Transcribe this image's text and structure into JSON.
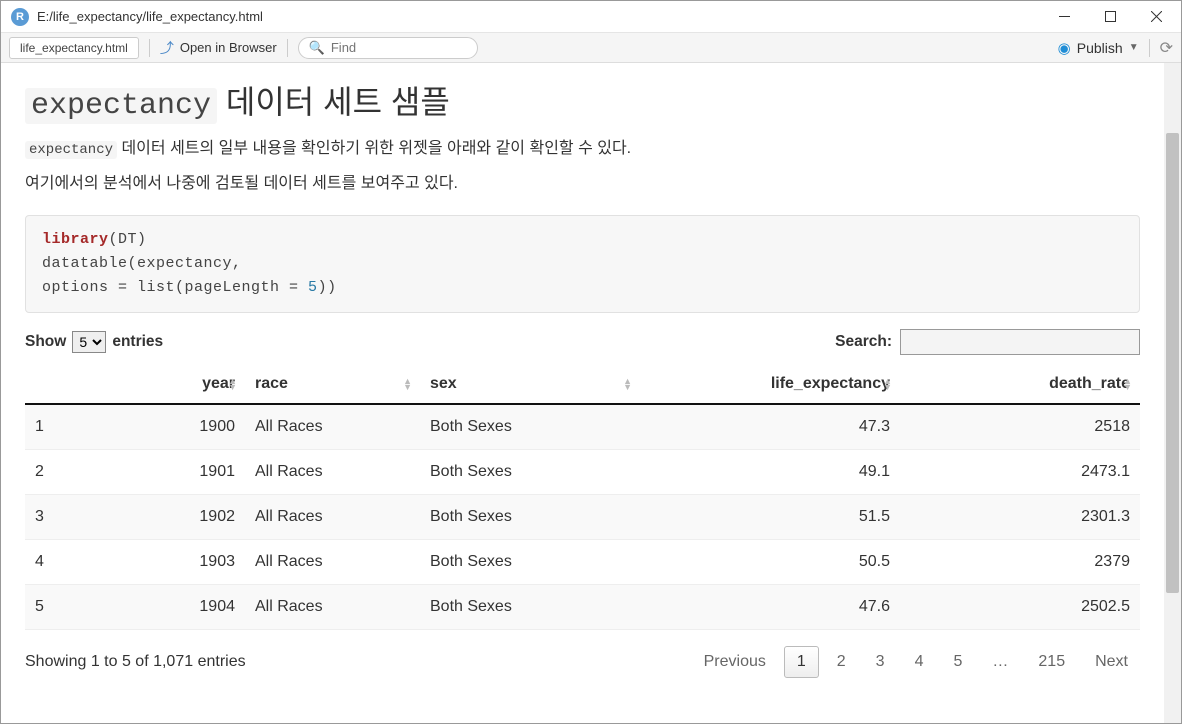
{
  "window": {
    "title": "E:/life_expectancy/life_expectancy.html",
    "app_icon_letter": "R"
  },
  "toolbar": {
    "file_tab": "life_expectancy.html",
    "open_browser": "Open in Browser",
    "find_placeholder": "Find",
    "publish": "Publish"
  },
  "page": {
    "heading_code": "expectancy",
    "heading_rest": " 데이터 세트 샘플",
    "intro_code": "expectancy",
    "intro_rest": " 데이터 세트의 일부 내용을 확인하기 위한 위젯을 아래와 같이 확인할 수 있다.",
    "intro2": "여기에서의 분석에서 나중에 검토될 데이터 세트를 보여주고 있다."
  },
  "code": {
    "kw": "library",
    "line1_rest": "(DT)",
    "line2": "datatable(expectancy,",
    "line3a": "options = list(pageLength = ",
    "line3_num": "5",
    "line3b": "))"
  },
  "dt": {
    "show": "Show",
    "entries": "entries",
    "page_length": "5",
    "search_label": "Search:",
    "search_value": "",
    "columns": [
      "",
      "year",
      "race",
      "sex",
      "life_expectancy",
      "death_rate"
    ],
    "rows": [
      {
        "idx": "1",
        "year": "1900",
        "race": "All Races",
        "sex": "Both Sexes",
        "le": "47.3",
        "dr": "2518"
      },
      {
        "idx": "2",
        "year": "1901",
        "race": "All Races",
        "sex": "Both Sexes",
        "le": "49.1",
        "dr": "2473.1"
      },
      {
        "idx": "3",
        "year": "1902",
        "race": "All Races",
        "sex": "Both Sexes",
        "le": "51.5",
        "dr": "2301.3"
      },
      {
        "idx": "4",
        "year": "1903",
        "race": "All Races",
        "sex": "Both Sexes",
        "le": "50.5",
        "dr": "2379"
      },
      {
        "idx": "5",
        "year": "1904",
        "race": "All Races",
        "sex": "Both Sexes",
        "le": "47.6",
        "dr": "2502.5"
      }
    ],
    "info": "Showing 1 to 5 of 1,071 entries",
    "pager": {
      "previous": "Previous",
      "pages": [
        "1",
        "2",
        "3",
        "4",
        "5",
        "…",
        "215"
      ],
      "next": "Next",
      "active": "1"
    }
  }
}
